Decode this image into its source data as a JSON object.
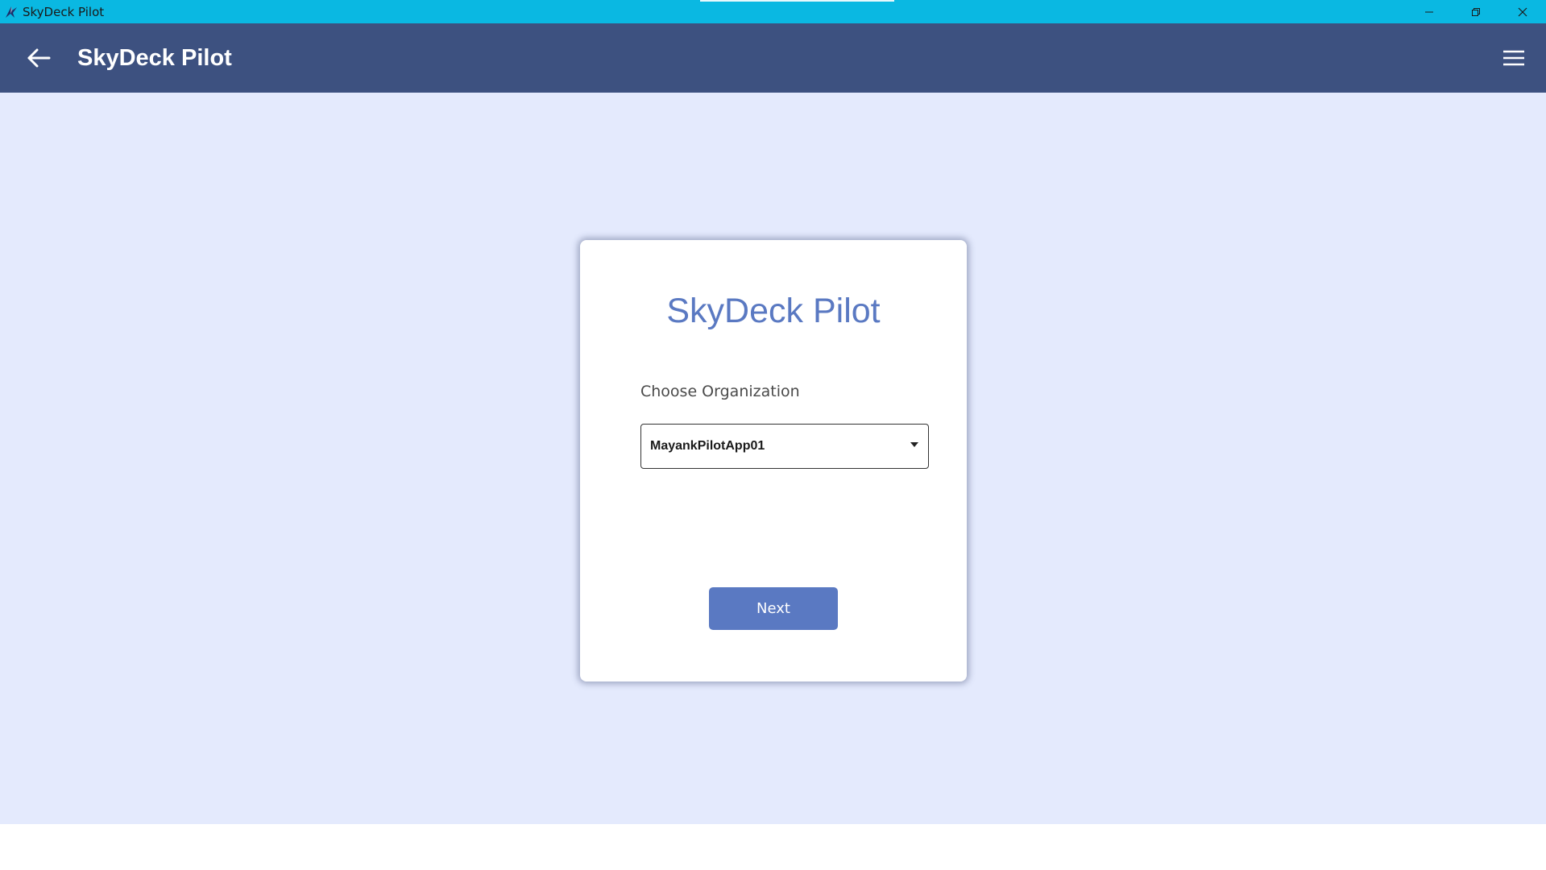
{
  "window": {
    "title": "SkyDeck Pilot",
    "controls": [
      "minimize-icon",
      "restore-icon",
      "close-icon"
    ]
  },
  "appbar": {
    "title": "SkyDeck Pilot",
    "back_icon": "arrow-left-icon",
    "menu_icon": "hamburger-menu-icon"
  },
  "card": {
    "title": "SkyDeck Pilot",
    "org_label": "Choose Organization",
    "org_selected": "MayankPilotApp01",
    "next_label": "Next"
  },
  "colors": {
    "titlebar": "#0ab8e2",
    "appbar": "#3d5180",
    "background": "#e4eafd",
    "accent": "#5a79c2"
  }
}
